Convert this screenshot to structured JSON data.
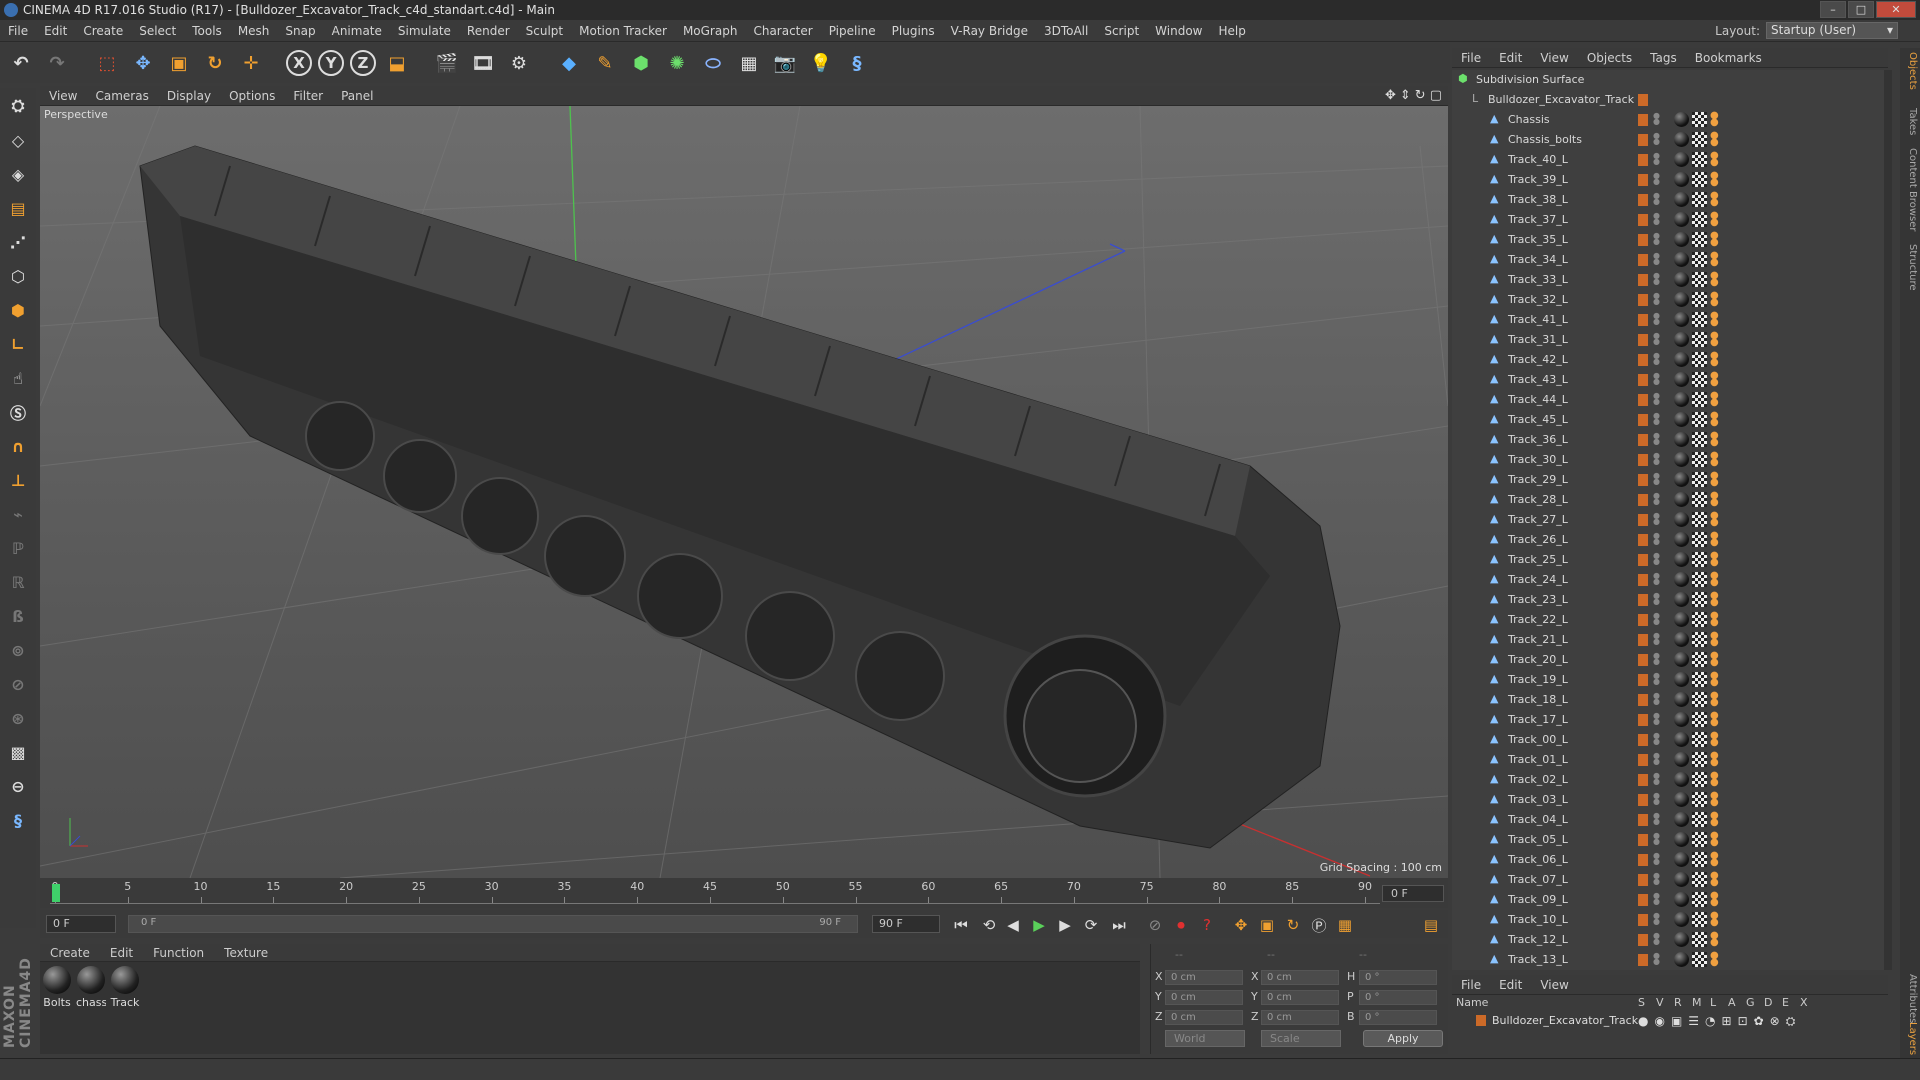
{
  "window": {
    "title": "CINEMA 4D R17.016 Studio (R17) - [Bulldozer_Excavator_Track_c4d_standart.c4d] - Main"
  },
  "menu": [
    "File",
    "Edit",
    "Create",
    "Select",
    "Tools",
    "Mesh",
    "Snap",
    "Animate",
    "Simulate",
    "Render",
    "Sculpt",
    "Motion Tracker",
    "MoGraph",
    "Character",
    "Pipeline",
    "Plugins",
    "V-Ray Bridge",
    "3DToAll",
    "Script",
    "Window",
    "Help"
  ],
  "layout": {
    "label": "Layout:",
    "value": "Startup (User)"
  },
  "viewport": {
    "menu": [
      "View",
      "Cameras",
      "Display",
      "Options",
      "Filter",
      "Panel"
    ],
    "label": "Perspective",
    "grid_spacing": "Grid Spacing : 100 cm"
  },
  "timeline": {
    "ticks": [
      "0",
      "5",
      "10",
      "15",
      "20",
      "25",
      "30",
      "35",
      "40",
      "45",
      "50",
      "55",
      "60",
      "65",
      "70",
      "75",
      "80",
      "85",
      "90"
    ],
    "current_frame": "0 F",
    "start_field": "0 F",
    "slider_start": "0 F",
    "slider_end": "90 F",
    "end_field": "90 F"
  },
  "materials": {
    "menu": [
      "Create",
      "Edit",
      "Function",
      "Texture"
    ],
    "items": [
      "Bolts",
      "chass",
      "Track"
    ]
  },
  "coords": {
    "header": [
      "--",
      "--",
      "--"
    ],
    "rows": [
      {
        "a": "X",
        "av": "0 cm",
        "b": "X",
        "bv": "0 cm",
        "c": "H",
        "cv": "0 °"
      },
      {
        "a": "Y",
        "av": "0 cm",
        "b": "Y",
        "bv": "0 cm",
        "c": "P",
        "cv": "0 °"
      },
      {
        "a": "Z",
        "av": "0 cm",
        "b": "Z",
        "bv": "0 cm",
        "c": "B",
        "cv": "0 °"
      }
    ],
    "mode1": "World",
    "mode2": "Scale",
    "apply": "Apply"
  },
  "objects": {
    "menu": [
      "File",
      "Edit",
      "View",
      "Objects",
      "Tags",
      "Bookmarks"
    ],
    "root": "Subdivision Surface",
    "group": "Bulldozer_Excavator_Track",
    "items": [
      "Chassis",
      "Chassis_bolts",
      "Track_40_L",
      "Track_39_L",
      "Track_38_L",
      "Track_37_L",
      "Track_35_L",
      "Track_34_L",
      "Track_33_L",
      "Track_32_L",
      "Track_41_L",
      "Track_31_L",
      "Track_42_L",
      "Track_43_L",
      "Track_44_L",
      "Track_45_L",
      "Track_36_L",
      "Track_30_L",
      "Track_29_L",
      "Track_28_L",
      "Track_27_L",
      "Track_26_L",
      "Track_25_L",
      "Track_24_L",
      "Track_23_L",
      "Track_22_L",
      "Track_21_L",
      "Track_20_L",
      "Track_19_L",
      "Track_18_L",
      "Track_17_L",
      "Track_00_L",
      "Track_01_L",
      "Track_02_L",
      "Track_03_L",
      "Track_04_L",
      "Track_05_L",
      "Track_06_L",
      "Track_07_L",
      "Track_09_L",
      "Track_10_L",
      "Track_12_L",
      "Track_13_L"
    ]
  },
  "layers": {
    "menu": [
      "File",
      "Edit",
      "View"
    ],
    "columns": [
      "Name",
      "S",
      "V",
      "R",
      "M",
      "L",
      "A",
      "G",
      "D",
      "E",
      "X"
    ],
    "row": "Bulldozer_Excavator_Track"
  },
  "right_tabs": [
    "Objects",
    "Takes",
    "Content Browser",
    "Structure",
    "Attributes",
    "Layers"
  ],
  "colors": {
    "accent": "#cc6a28",
    "bg": "#3a3a3a",
    "viewport": "#5f5f5f"
  }
}
